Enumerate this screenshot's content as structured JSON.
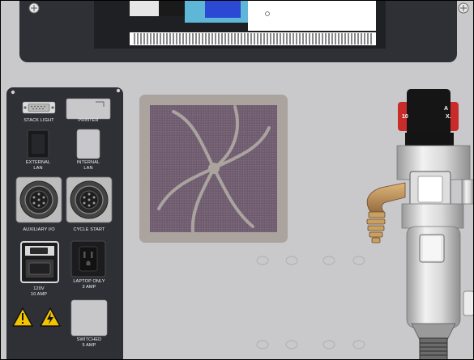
{
  "app": {
    "title": ""
  },
  "connector_panel": {
    "stack_light": "STACK LIGHT",
    "printer": "PRINTER",
    "external_lan": [
      "EXTERNAL",
      "LAN"
    ],
    "internal_lan": [
      "INTERNAL",
      "LAN"
    ],
    "auxiliary_io": "AUXILIARY I/O",
    "cycle_start": "CYCLE START",
    "power_120v": [
      "120V",
      "10 AMP"
    ],
    "laptop_only": [
      "LAPTOP ONLY",
      "3 AMP"
    ],
    "switched": [
      "SWITCHED",
      "5 AMP"
    ]
  },
  "warning_label": {
    "lines": [
      "A",
      "10",
      "X."
    ]
  },
  "colors": {
    "background": "#c9c9cb",
    "panel": "#2e3036",
    "fan_grille": "#6e5c6e",
    "warning_red": "#c82c2a",
    "warning_yellow": "#f2c400",
    "monitor_blue": "#2c49d4",
    "brass": "#b58a5a"
  },
  "icons": [
    "warning-triangle-icon",
    "electrical-hazard-icon",
    "screw-icon",
    "fan-grille-icon"
  ]
}
